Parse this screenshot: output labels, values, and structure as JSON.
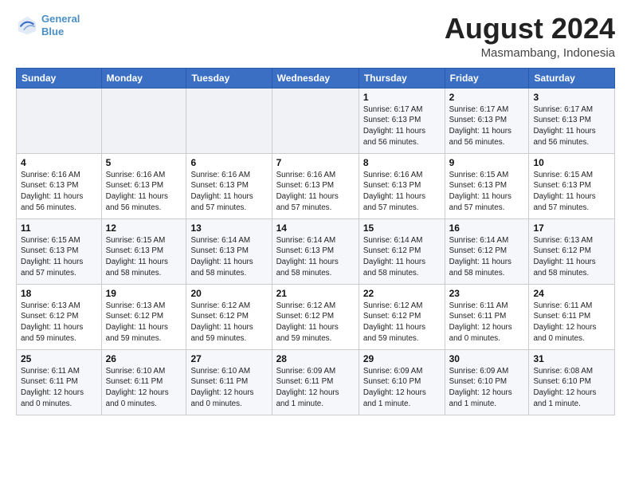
{
  "header": {
    "logo_line1": "General",
    "logo_line2": "Blue",
    "month_title": "August 2024",
    "location": "Masmambang, Indonesia"
  },
  "weekdays": [
    "Sunday",
    "Monday",
    "Tuesday",
    "Wednesday",
    "Thursday",
    "Friday",
    "Saturday"
  ],
  "weeks": [
    [
      {
        "day": "",
        "info": ""
      },
      {
        "day": "",
        "info": ""
      },
      {
        "day": "",
        "info": ""
      },
      {
        "day": "",
        "info": ""
      },
      {
        "day": "1",
        "info": "Sunrise: 6:17 AM\nSunset: 6:13 PM\nDaylight: 11 hours\nand 56 minutes."
      },
      {
        "day": "2",
        "info": "Sunrise: 6:17 AM\nSunset: 6:13 PM\nDaylight: 11 hours\nand 56 minutes."
      },
      {
        "day": "3",
        "info": "Sunrise: 6:17 AM\nSunset: 6:13 PM\nDaylight: 11 hours\nand 56 minutes."
      }
    ],
    [
      {
        "day": "4",
        "info": "Sunrise: 6:16 AM\nSunset: 6:13 PM\nDaylight: 11 hours\nand 56 minutes."
      },
      {
        "day": "5",
        "info": "Sunrise: 6:16 AM\nSunset: 6:13 PM\nDaylight: 11 hours\nand 56 minutes."
      },
      {
        "day": "6",
        "info": "Sunrise: 6:16 AM\nSunset: 6:13 PM\nDaylight: 11 hours\nand 57 minutes."
      },
      {
        "day": "7",
        "info": "Sunrise: 6:16 AM\nSunset: 6:13 PM\nDaylight: 11 hours\nand 57 minutes."
      },
      {
        "day": "8",
        "info": "Sunrise: 6:16 AM\nSunset: 6:13 PM\nDaylight: 11 hours\nand 57 minutes."
      },
      {
        "day": "9",
        "info": "Sunrise: 6:15 AM\nSunset: 6:13 PM\nDaylight: 11 hours\nand 57 minutes."
      },
      {
        "day": "10",
        "info": "Sunrise: 6:15 AM\nSunset: 6:13 PM\nDaylight: 11 hours\nand 57 minutes."
      }
    ],
    [
      {
        "day": "11",
        "info": "Sunrise: 6:15 AM\nSunset: 6:13 PM\nDaylight: 11 hours\nand 57 minutes."
      },
      {
        "day": "12",
        "info": "Sunrise: 6:15 AM\nSunset: 6:13 PM\nDaylight: 11 hours\nand 58 minutes."
      },
      {
        "day": "13",
        "info": "Sunrise: 6:14 AM\nSunset: 6:13 PM\nDaylight: 11 hours\nand 58 minutes."
      },
      {
        "day": "14",
        "info": "Sunrise: 6:14 AM\nSunset: 6:13 PM\nDaylight: 11 hours\nand 58 minutes."
      },
      {
        "day": "15",
        "info": "Sunrise: 6:14 AM\nSunset: 6:12 PM\nDaylight: 11 hours\nand 58 minutes."
      },
      {
        "day": "16",
        "info": "Sunrise: 6:14 AM\nSunset: 6:12 PM\nDaylight: 11 hours\nand 58 minutes."
      },
      {
        "day": "17",
        "info": "Sunrise: 6:13 AM\nSunset: 6:12 PM\nDaylight: 11 hours\nand 58 minutes."
      }
    ],
    [
      {
        "day": "18",
        "info": "Sunrise: 6:13 AM\nSunset: 6:12 PM\nDaylight: 11 hours\nand 59 minutes."
      },
      {
        "day": "19",
        "info": "Sunrise: 6:13 AM\nSunset: 6:12 PM\nDaylight: 11 hours\nand 59 minutes."
      },
      {
        "day": "20",
        "info": "Sunrise: 6:12 AM\nSunset: 6:12 PM\nDaylight: 11 hours\nand 59 minutes."
      },
      {
        "day": "21",
        "info": "Sunrise: 6:12 AM\nSunset: 6:12 PM\nDaylight: 11 hours\nand 59 minutes."
      },
      {
        "day": "22",
        "info": "Sunrise: 6:12 AM\nSunset: 6:12 PM\nDaylight: 11 hours\nand 59 minutes."
      },
      {
        "day": "23",
        "info": "Sunrise: 6:11 AM\nSunset: 6:11 PM\nDaylight: 12 hours\nand 0 minutes."
      },
      {
        "day": "24",
        "info": "Sunrise: 6:11 AM\nSunset: 6:11 PM\nDaylight: 12 hours\nand 0 minutes."
      }
    ],
    [
      {
        "day": "25",
        "info": "Sunrise: 6:11 AM\nSunset: 6:11 PM\nDaylight: 12 hours\nand 0 minutes."
      },
      {
        "day": "26",
        "info": "Sunrise: 6:10 AM\nSunset: 6:11 PM\nDaylight: 12 hours\nand 0 minutes."
      },
      {
        "day": "27",
        "info": "Sunrise: 6:10 AM\nSunset: 6:11 PM\nDaylight: 12 hours\nand 0 minutes."
      },
      {
        "day": "28",
        "info": "Sunrise: 6:09 AM\nSunset: 6:11 PM\nDaylight: 12 hours\nand 1 minute."
      },
      {
        "day": "29",
        "info": "Sunrise: 6:09 AM\nSunset: 6:10 PM\nDaylight: 12 hours\nand 1 minute."
      },
      {
        "day": "30",
        "info": "Sunrise: 6:09 AM\nSunset: 6:10 PM\nDaylight: 12 hours\nand 1 minute."
      },
      {
        "day": "31",
        "info": "Sunrise: 6:08 AM\nSunset: 6:10 PM\nDaylight: 12 hours\nand 1 minute."
      }
    ]
  ]
}
